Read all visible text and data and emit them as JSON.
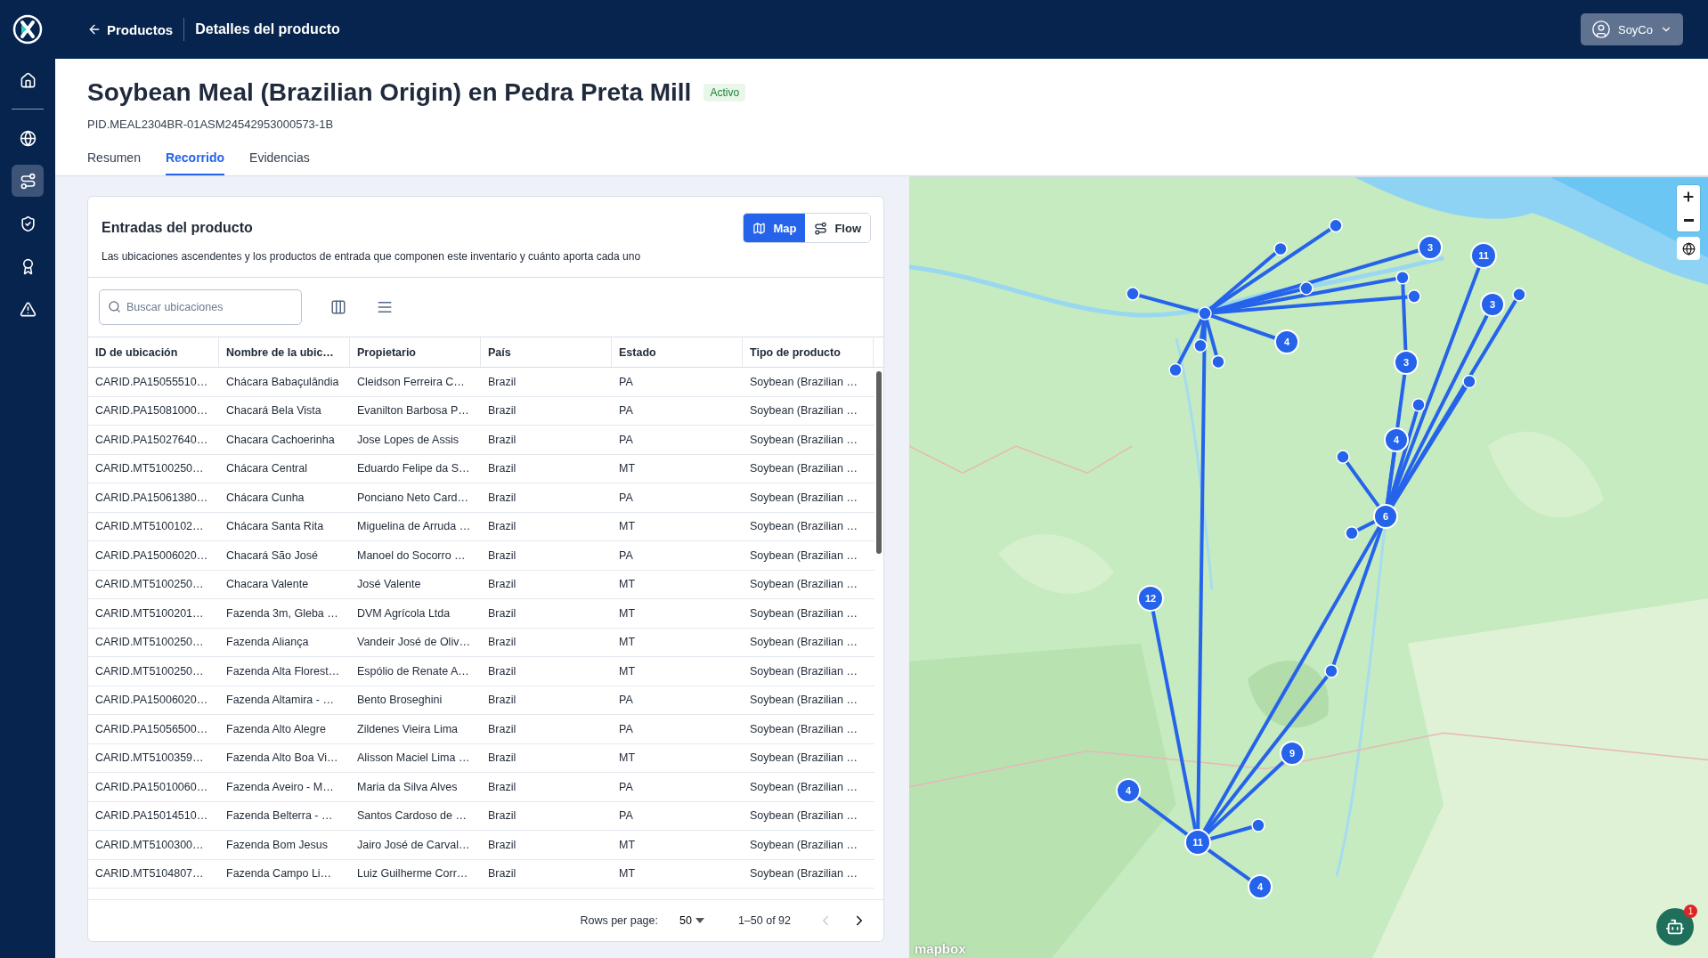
{
  "header": {
    "back_link": "Productos",
    "breadcrumb": "Detalles del producto",
    "account": "SoyCo"
  },
  "sidebar": {
    "items": [
      {
        "kind": "home",
        "selected": false
      },
      {
        "kind": "globe",
        "selected": false
      },
      {
        "kind": "route",
        "selected": true
      },
      {
        "kind": "shield",
        "selected": false
      },
      {
        "kind": "award",
        "selected": false
      },
      {
        "kind": "alert",
        "selected": false
      }
    ]
  },
  "product": {
    "title": "Soybean Meal (Brazilian Origin) en Pedra Preta Mill",
    "status": "Activo",
    "pid": "PID.MEAL2304BR-01ASM24542953000573-1B"
  },
  "tabs": [
    {
      "label": "Resumen",
      "selected": false
    },
    {
      "label": "Recorrido",
      "selected": true
    },
    {
      "label": "Evidencias",
      "selected": false
    }
  ],
  "inputs_card": {
    "title": "Entradas del producto",
    "description": "Las ubicaciones ascendentes y los productos de entrada que componen este inventario y cuánto aporta cada uno",
    "view_toggle": [
      {
        "kind": "map",
        "label": "Map",
        "selected": true
      },
      {
        "kind": "flow",
        "label": "Flow",
        "selected": false
      }
    ],
    "search": {
      "placeholder": "Buscar ubicaciones"
    },
    "table": {
      "columns": [
        "ID de ubicación",
        "Nombre de la ubic…",
        "Propietario",
        "País",
        "Estado",
        "Tipo de producto"
      ],
      "rows": [
        [
          "CARID.PA15055510…",
          "Chácara Babaçulândia",
          "Cleidson Ferreira C…",
          "Brazil",
          "PA",
          "Soybean (Brazilian …"
        ],
        [
          "CARID.PA15081000…",
          "Chacará Bela Vista",
          "Evanilton Barbosa P…",
          "Brazil",
          "PA",
          "Soybean (Brazilian …"
        ],
        [
          "CARID.PA15027640…",
          "Chacara Cachoerinha",
          "Jose Lopes de Assis",
          "Brazil",
          "PA",
          "Soybean (Brazilian …"
        ],
        [
          "CARID.MT5100250…",
          "Chácara Central",
          "Eduardo Felipe da S…",
          "Brazil",
          "MT",
          "Soybean (Brazilian …"
        ],
        [
          "CARID.PA15061380…",
          "Chácara Cunha",
          "Ponciano Neto Card…",
          "Brazil",
          "PA",
          "Soybean (Brazilian …"
        ],
        [
          "CARID.MT5100102…",
          "Chácara Santa Rita",
          "Miguelina de Arruda …",
          "Brazil",
          "MT",
          "Soybean (Brazilian …"
        ],
        [
          "CARID.PA15006020…",
          "Chacará São José",
          "Manoel do Socorro …",
          "Brazil",
          "PA",
          "Soybean (Brazilian …"
        ],
        [
          "CARID.MT5100250…",
          "Chacara Valente",
          "José Valente",
          "Brazil",
          "MT",
          "Soybean (Brazilian …"
        ],
        [
          "CARID.MT5100201…",
          "Fazenda 3m, Gleba …",
          "DVM Agrícola Ltda",
          "Brazil",
          "MT",
          "Soybean (Brazilian …"
        ],
        [
          "CARID.MT5100250…",
          "Fazenda Aliança",
          "Vandeir José de Oliv…",
          "Brazil",
          "MT",
          "Soybean (Brazilian …"
        ],
        [
          "CARID.MT5100250…",
          "Fazenda Alta Florest…",
          "Espólio de Renate A…",
          "Brazil",
          "MT",
          "Soybean (Brazilian …"
        ],
        [
          "CARID.PA15006020…",
          "Fazenda Altamira - …",
          "Bento Broseghini",
          "Brazil",
          "PA",
          "Soybean (Brazilian …"
        ],
        [
          "CARID.PA15056500…",
          "Fazenda Alto Alegre",
          "Zildenes Vieira Lima",
          "Brazil",
          "PA",
          "Soybean (Brazilian …"
        ],
        [
          "CARID.MT5100359…",
          "Fazenda Alto Boa Vi…",
          "Alisson Maciel Lima …",
          "Brazil",
          "MT",
          "Soybean (Brazilian …"
        ],
        [
          "CARID.PA15010060…",
          "Fazenda Aveiro - M…",
          "Maria da Silva Alves",
          "Brazil",
          "PA",
          "Soybean (Brazilian …"
        ],
        [
          "CARID.PA15014510…",
          "Fazenda Belterra - …",
          "Santos Cardoso de …",
          "Brazil",
          "PA",
          "Soybean (Brazilian …"
        ],
        [
          "CARID.MT5100300…",
          "Fazenda Bom Jesus",
          "Jairo José de Carval…",
          "Brazil",
          "MT",
          "Soybean (Brazilian …"
        ],
        [
          "CARID.MT5104807…",
          "Fazenda Campo Li…",
          "Luiz Guilherme Corr…",
          "Brazil",
          "MT",
          "Soybean (Brazilian …"
        ]
      ]
    },
    "pagination": {
      "rows_per_page_label": "Rows per page:",
      "rows_per_page": "50",
      "range": "1–50 of 92",
      "prev": {
        "disabled": true
      },
      "next": {
        "disabled": false
      }
    }
  },
  "map": {
    "clusters": [
      {
        "count": "3"
      },
      {
        "count": "11"
      },
      {
        "count": "3"
      },
      {
        "count": "4"
      },
      {
        "count": "3"
      },
      {
        "count": "4"
      },
      {
        "count": "6"
      },
      {
        "count": "12"
      },
      {
        "count": "9"
      },
      {
        "count": "4"
      },
      {
        "count": "11"
      },
      {
        "count": "4"
      }
    ],
    "attribution": "mapbox",
    "help_badge": "1"
  }
}
